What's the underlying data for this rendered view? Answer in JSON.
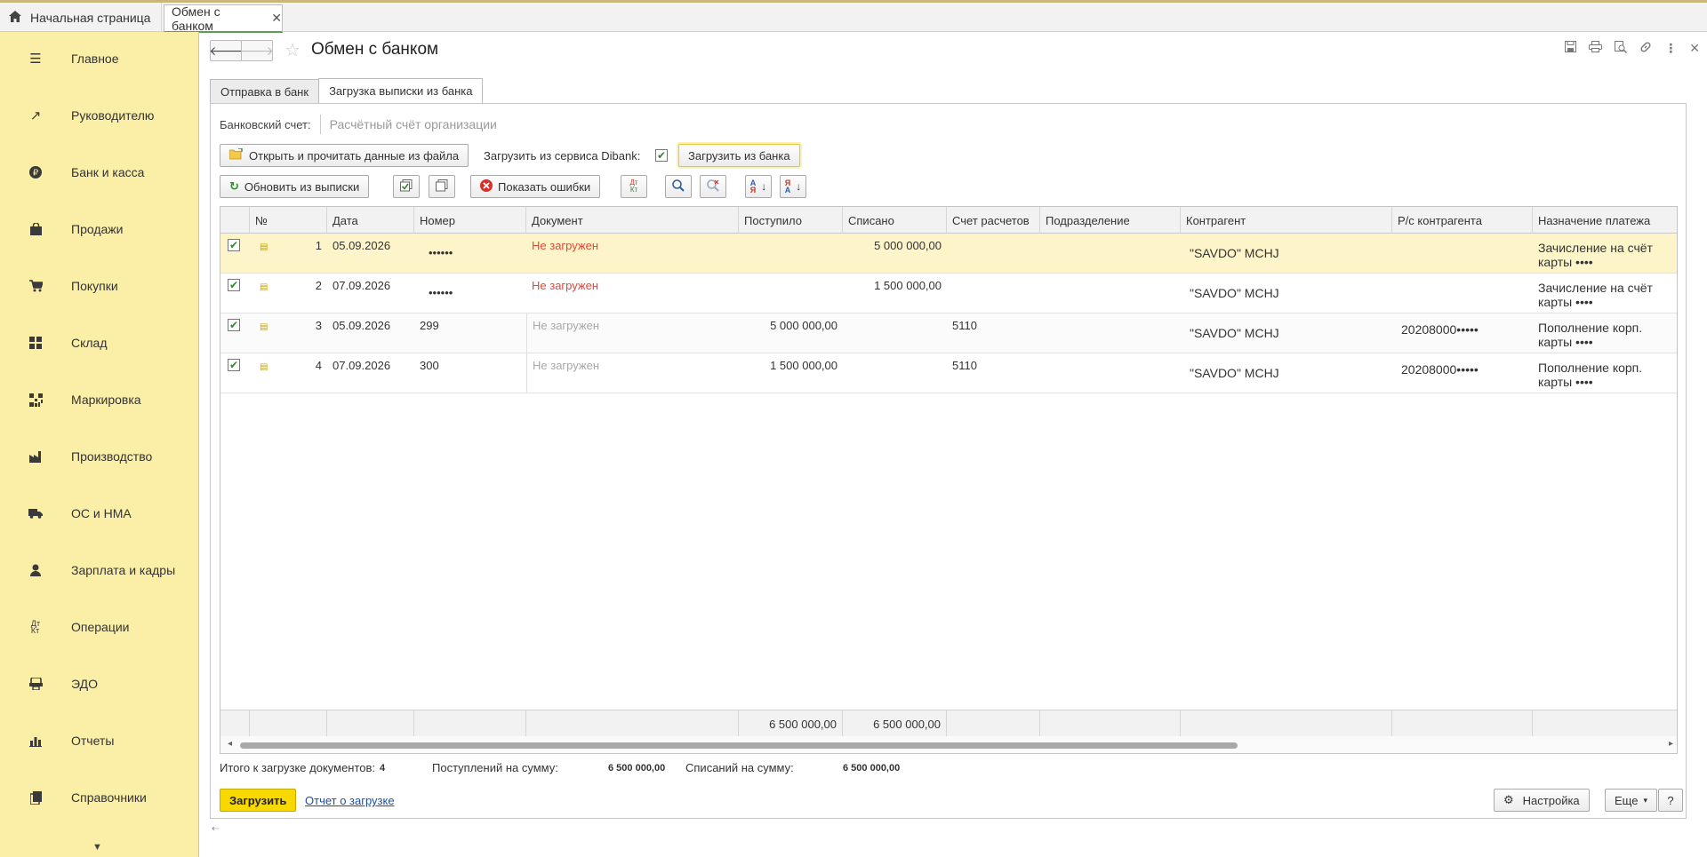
{
  "topbar": {
    "home_label": "Начальная страница",
    "open_tab": "Обмен с банком"
  },
  "sidebar": {
    "items": [
      {
        "label": "Главное",
        "icon": "menu-icon"
      },
      {
        "label": "Руководителю",
        "icon": "trend-icon"
      },
      {
        "label": "Банк и касса",
        "icon": "ruble-icon"
      },
      {
        "label": "Продажи",
        "icon": "bag-icon"
      },
      {
        "label": "Покупки",
        "icon": "cart-icon"
      },
      {
        "label": "Склад",
        "icon": "grid-icon"
      },
      {
        "label": "Маркировка",
        "icon": "qr-icon"
      },
      {
        "label": "Производство",
        "icon": "factory-icon"
      },
      {
        "label": "ОС и НМА",
        "icon": "truck-icon"
      },
      {
        "label": "Зарплата и кадры",
        "icon": "person-icon"
      },
      {
        "label": "Операции",
        "icon": "dtkt-icon"
      },
      {
        "label": "ЭДО",
        "icon": "edo-icon"
      },
      {
        "label": "Отчеты",
        "icon": "chart-icon"
      },
      {
        "label": "Справочники",
        "icon": "book-icon"
      }
    ]
  },
  "form": {
    "title": "Обмен с банком",
    "tabs": [
      "Отправка в банк",
      "Загрузка выписки из банка"
    ],
    "bank_account_label": "Банковский счет:",
    "bank_account_placeholder": "Расчётный счёт организации",
    "open_file_button": "Открыть и прочитать данные из файла",
    "dibank_label": "Загрузить из сервиса Dibank:",
    "load_from_bank_button": "Загрузить из банка",
    "refresh_button": "Обновить из выписки",
    "show_errors_button": "Показать ошибки"
  },
  "table": {
    "columns": [
      "№",
      "Дата",
      "Номер",
      "Документ",
      "Поступило",
      "Списано",
      "Счет расчетов",
      "Подразделение",
      "Контрагент",
      "Р/с контрагента",
      "Назначение платежа"
    ],
    "rows": [
      {
        "n": "1",
        "date": "05.09.2026",
        "number": "••••••",
        "doc": "Не загружен",
        "in": "",
        "out": "5 000 000,00",
        "acc": "",
        "dept": "",
        "contragent": "\"SAVDO\" MCHJ",
        "rs": "",
        "purpose": "Зачисление на счёт карты ••••"
      },
      {
        "n": "2",
        "date": "07.09.2026",
        "number": "••••••",
        "doc": "Не загружен",
        "in": "",
        "out": "1 500 000,00",
        "acc": "",
        "dept": "",
        "contragent": "\"SAVDO\" MCHJ",
        "rs": "",
        "purpose": "Зачисление на счёт карты ••••"
      },
      {
        "n": "3",
        "date": "05.09.2026",
        "number": "299",
        "doc": "Не загружен",
        "in": "5 000 000,00",
        "out": "",
        "acc": "5110",
        "dept": "",
        "contragent": "\"SAVDO\" MCHJ",
        "rs": "20208000•••••",
        "purpose": "Пополнение корп. карты ••••"
      },
      {
        "n": "4",
        "date": "07.09.2026",
        "number": "300",
        "doc": "Не загружен",
        "in": "1 500 000,00",
        "out": "",
        "acc": "5110",
        "dept": "",
        "contragent": "\"SAVDO\" MCHJ",
        "rs": "20208000•••••",
        "purpose": "Пополнение корп. карты ••••"
      }
    ],
    "totals": {
      "in": "6 500 000,00",
      "out": "6 500 000,00"
    }
  },
  "summary": {
    "docs_label": "Итого к загрузке документов:",
    "docs_value": "4",
    "in_label": "Поступлений на сумму:",
    "in_value": "6 500 000,00",
    "out_label": "Списаний на сумму:",
    "out_value": "6 500 000,00"
  },
  "footer": {
    "load_button": "Загрузить",
    "report_link": "Отчет о загрузке",
    "settings_button": "Настройка",
    "more_button": "Еще",
    "help_button": "?"
  },
  "colors": {
    "sidebar_bg": "#fbeea6",
    "accent": "#f7d800",
    "error": "#e0493a"
  }
}
